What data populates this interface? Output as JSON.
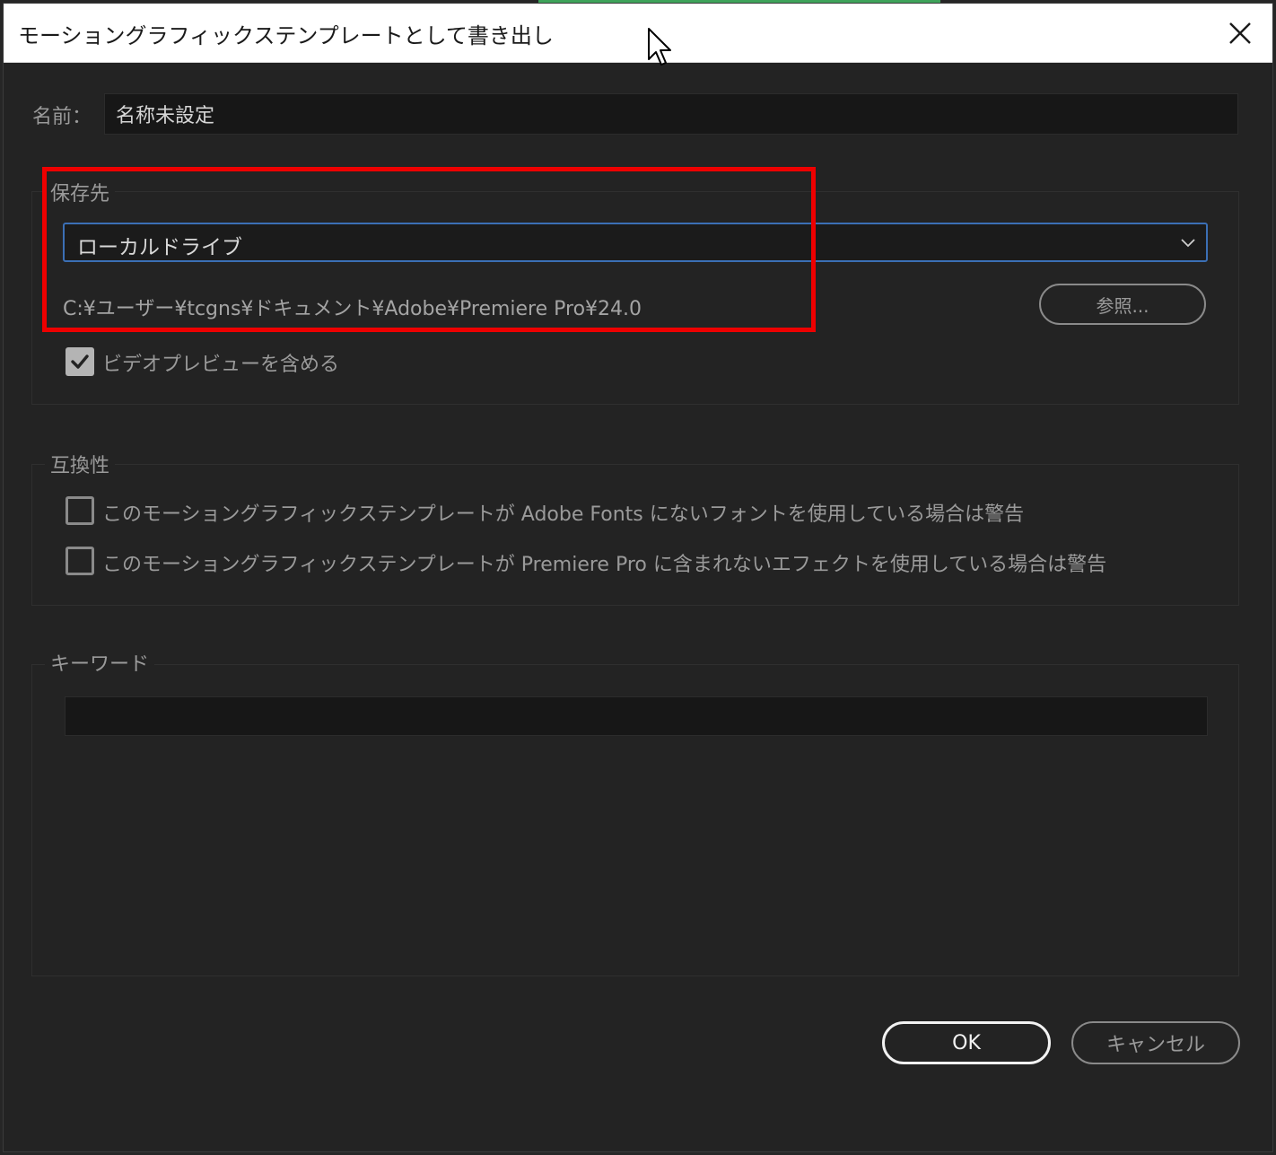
{
  "window": {
    "title": "モーショングラフィックステンプレートとして書き出し",
    "close_icon": "close-icon"
  },
  "name_field": {
    "label": "名前：",
    "value": "名称未設定"
  },
  "save_destination": {
    "legend": "保存先",
    "dropdown_value": "ローカルドライブ",
    "path": "C:¥ユーザー¥tcgns¥ドキュメント¥Adobe¥Premiere Pro¥24.0",
    "browse_label": "参照...",
    "include_video_preview": {
      "label": "ビデオプレビューを含める",
      "checked": true
    }
  },
  "compatibility": {
    "legend": "互換性",
    "options": [
      {
        "label": "このモーショングラフィックステンプレートが Adobe Fonts にないフォントを使用している場合は警告",
        "checked": false
      },
      {
        "label": "このモーショングラフィックステンプレートが Premiere Pro に含まれないエフェクトを使用している場合は警告",
        "checked": false
      }
    ]
  },
  "keywords": {
    "legend": "キーワード",
    "value": ""
  },
  "footer": {
    "ok_label": "OK",
    "cancel_label": "キャンセル"
  },
  "colors": {
    "highlight": "#ee0000",
    "focus_border": "#3b6fb5",
    "dialog_bg": "#232323"
  }
}
